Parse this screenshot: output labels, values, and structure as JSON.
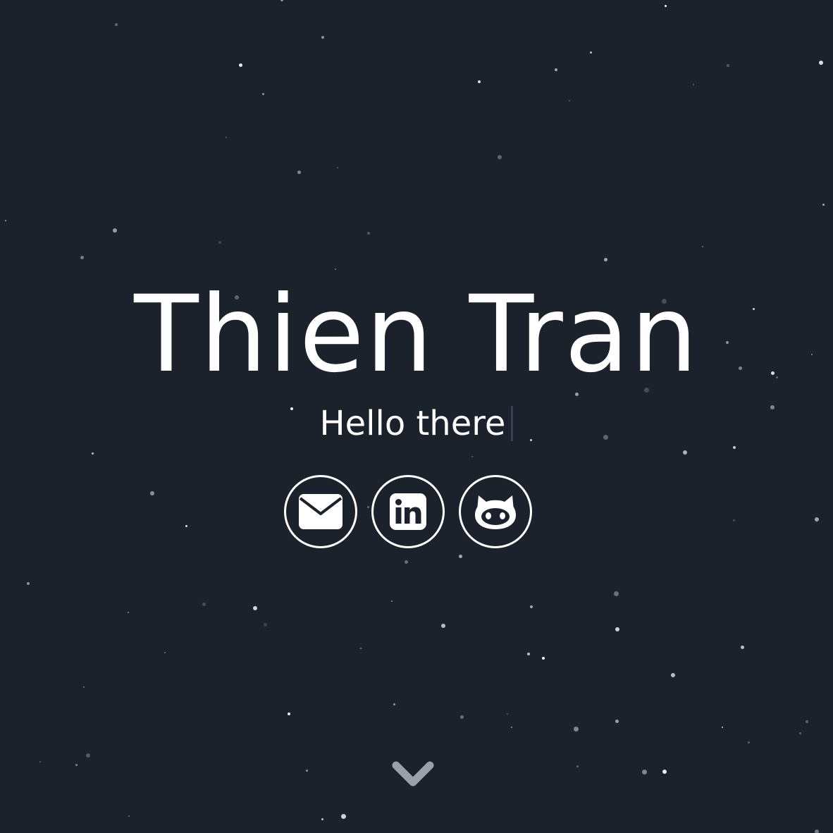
{
  "hero": {
    "name": "Thien Tran",
    "greeting": "Hello there"
  },
  "socials": [
    {
      "label": "Email",
      "icon": "envelope-icon"
    },
    {
      "label": "LinkedIn",
      "icon": "linkedin-icon"
    },
    {
      "label": "GitHub",
      "icon": "github-icon"
    }
  ],
  "scroll_indicator": {
    "icon": "chevron-down-icon"
  },
  "colors": {
    "background": "#1c222c",
    "text": "#ffffff",
    "star": "#ffffff",
    "cursor": "#3a4150",
    "chevron": "#9aa0aa"
  }
}
